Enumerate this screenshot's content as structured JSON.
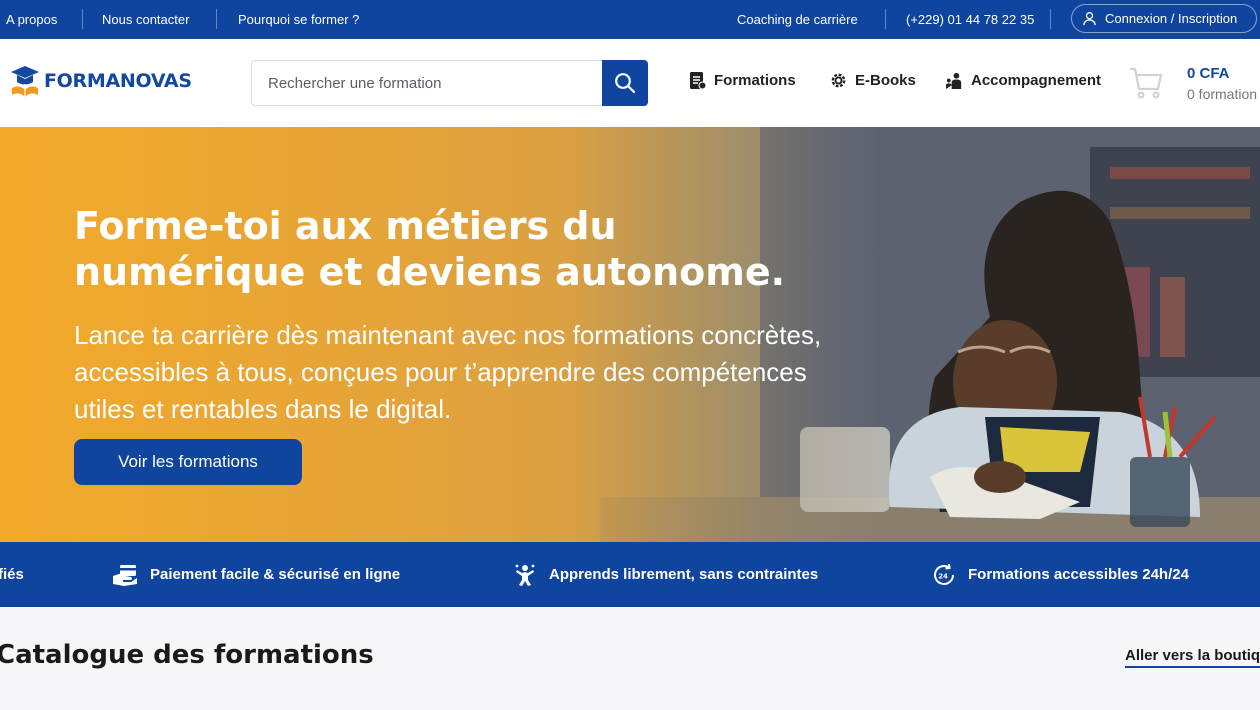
{
  "topbar": {
    "links": [
      "A propos",
      "Nous contacter",
      "Pourquoi se former ?"
    ],
    "coaching": "Coaching de carrière",
    "phone": "(+229) 01 44 78 22 35",
    "login": "Connexion / Inscription"
  },
  "header": {
    "logo": "FORMANOVAS",
    "search_placeholder": "Rechercher une formation",
    "nav": [
      "Formations",
      "E-Books",
      "Accompagnement"
    ],
    "cart_amount": "0 CFA",
    "cart_count": "0 formation"
  },
  "hero": {
    "title": "Forme-toi aux métiers du numérique et deviens autonome.",
    "subtitle": "Lance ta carrière dès maintenant avec nos formations concrètes, accessibles à tous, conçues pour t’apprendre des compétences utiles et rentables dans le digital.",
    "cta": "Voir les formations"
  },
  "features": {
    "items": [
      "fiés",
      "Paiement facile & sécurisé en ligne",
      "Apprends librement, sans contraintes",
      "Formations accessibles 24h/24"
    ]
  },
  "catalog": {
    "title": "Catalogue des formations",
    "link": "Aller vers la boutique"
  },
  "colors": {
    "primary": "#10459f",
    "accent": "#f2a92a"
  }
}
